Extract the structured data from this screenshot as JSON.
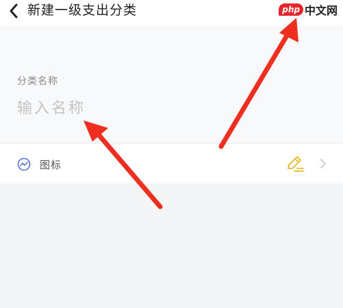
{
  "header": {
    "title": "新建一级支出分类",
    "back_icon": "chevron-left-icon"
  },
  "watermark": {
    "php": "php",
    "cn": "中文网"
  },
  "name_field": {
    "label": "分类名称",
    "placeholder": "输入名称",
    "value": ""
  },
  "icon_row": {
    "label": "图标",
    "leading_icon": "trend-circle-icon",
    "selected_icon": "pencil-icon",
    "trailing_icon": "chevron-right-icon"
  },
  "colors": {
    "header_bg": "#ffffff",
    "section_bg": "#f8f9fb",
    "page_bg": "#f4f5f7",
    "icon_accent": "#5b6fd6",
    "pencil_accent": "#e8b923",
    "arrow": "#ee2e1f"
  }
}
